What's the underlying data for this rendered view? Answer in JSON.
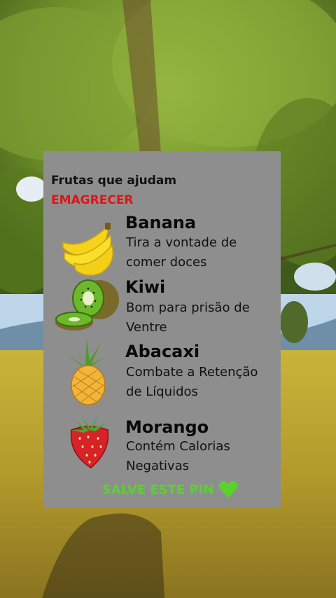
{
  "card": {
    "title": "Frutas que ajudam",
    "subtitle": "EMAGRECER",
    "fruits": [
      {
        "name": "Banana",
        "desc_line1": "Tira a vontade de",
        "desc_line2": "comer doces"
      },
      {
        "name": "Kiwi",
        "desc_line1": "Bom para prisão de",
        "desc_line2": "Ventre"
      },
      {
        "name": "Abacaxi",
        "desc_line1": "Combate a Retenção",
        "desc_line2": "de Líquidos"
      },
      {
        "name": "Morango",
        "desc_line1": "Contém Calorias",
        "desc_line2": "Negativas"
      }
    ],
    "save_label": "SALVE ESTE PIN"
  },
  "colors": {
    "card_bg": "#8f8e8e",
    "accent_red": "#e01414",
    "accent_green": "#5bd12e"
  }
}
